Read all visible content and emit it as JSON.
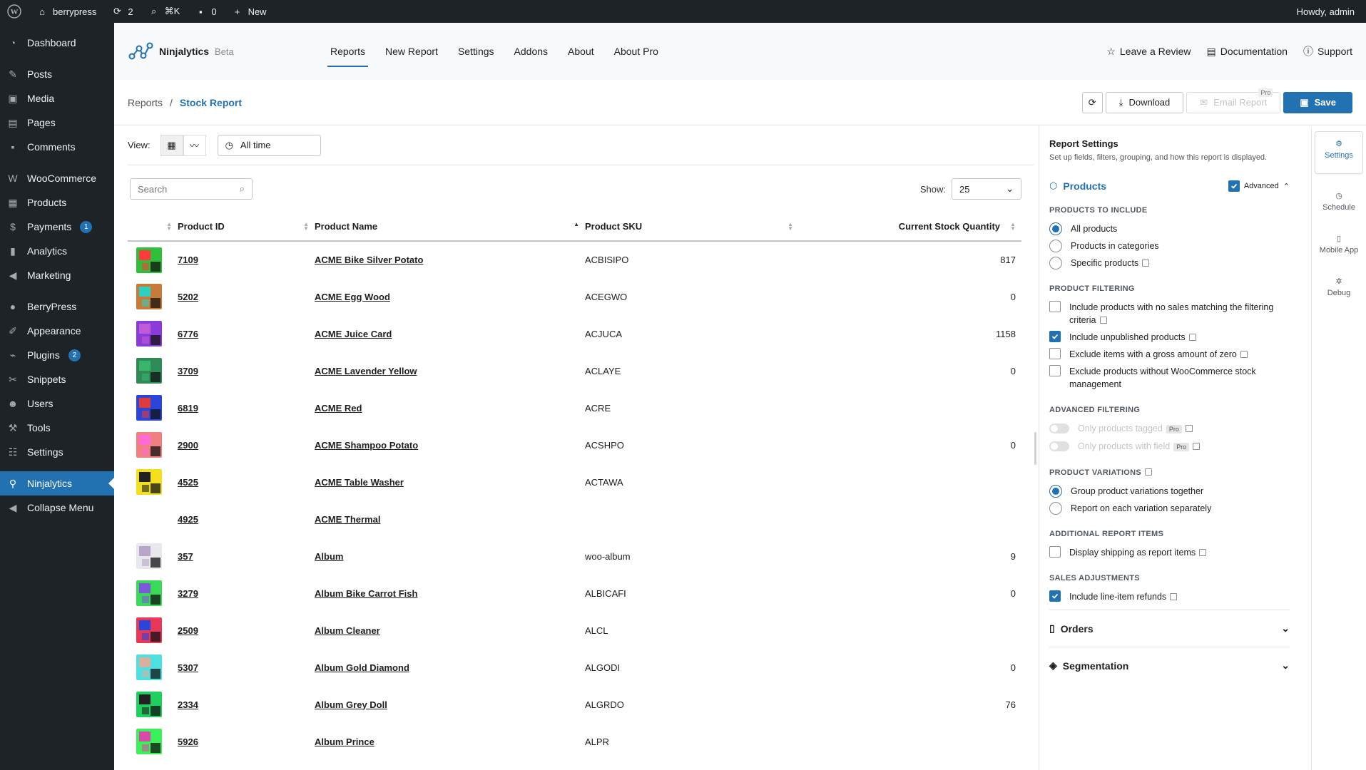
{
  "adminbar": {
    "site": "berrypress",
    "updates": "2",
    "shortcut": "⌘K",
    "comments": "0",
    "new": "New",
    "howdy": "Howdy, admin"
  },
  "sidebar": {
    "items": [
      {
        "label": "Dashboard",
        "icon": "dashboard-icon"
      },
      {
        "label": "Posts",
        "icon": "pin-icon"
      },
      {
        "label": "Media",
        "icon": "media-icon"
      },
      {
        "label": "Pages",
        "icon": "pages-icon"
      },
      {
        "label": "Comments",
        "icon": "comment-icon"
      },
      {
        "label": "WooCommerce",
        "icon": "woo-icon"
      },
      {
        "label": "Products",
        "icon": "box-icon"
      },
      {
        "label": "Payments",
        "icon": "dollar-icon",
        "badge": "1"
      },
      {
        "label": "Analytics",
        "icon": "bars-icon"
      },
      {
        "label": "Marketing",
        "icon": "megaphone-icon"
      },
      {
        "label": "BerryPress",
        "icon": "berry-icon"
      },
      {
        "label": "Appearance",
        "icon": "brush-icon"
      },
      {
        "label": "Plugins",
        "icon": "plug-icon",
        "badge": "2"
      },
      {
        "label": "Snippets",
        "icon": "scissors-icon"
      },
      {
        "label": "Users",
        "icon": "user-icon"
      },
      {
        "label": "Tools",
        "icon": "wrench-icon"
      },
      {
        "label": "Settings",
        "icon": "sliders-icon"
      },
      {
        "label": "Ninjalytics",
        "icon": "ninjalytics-icon"
      },
      {
        "label": "Collapse Menu",
        "icon": "collapse-icon"
      }
    ]
  },
  "app": {
    "name": "Ninjalytics",
    "beta": "Beta",
    "tabs": [
      "Reports",
      "New Report",
      "Settings",
      "Addons",
      "About",
      "About Pro"
    ],
    "links": [
      "Leave a Review",
      "Documentation",
      "Support"
    ]
  },
  "header": {
    "crumb_root": "Reports",
    "crumb_sep": "/",
    "crumb_current": "Stock Report",
    "download": "Download",
    "email": "Email Report",
    "pro": "Pro",
    "save": "Save"
  },
  "view": {
    "label": "View:",
    "time": "All time"
  },
  "table": {
    "search_placeholder": "Search",
    "show_label": "Show:",
    "show_value": "25",
    "columns": [
      "Product ID",
      "Product Name",
      "Product SKU",
      "Current Stock Quantity"
    ],
    "rows": [
      {
        "id": "7109",
        "name": "ACME Bike Silver Potato",
        "sku": "ACBISIPO",
        "qty": "817",
        "c1": "#2fbf3a",
        "c2": "#ff3b3b"
      },
      {
        "id": "5202",
        "name": "ACME Egg Wood",
        "sku": "ACEGWO",
        "qty": "0",
        "c1": "#c77b3b",
        "c2": "#2fd0c0"
      },
      {
        "id": "6776",
        "name": "ACME Juice Card",
        "sku": "ACJUCA",
        "qty": "1158",
        "c1": "#8a3bd8",
        "c2": "#c05ad8"
      },
      {
        "id": "3709",
        "name": "ACME Lavender Yellow",
        "sku": "ACLAYE",
        "qty": "0",
        "c1": "#2e8b57",
        "c2": "#3bb56a"
      },
      {
        "id": "6819",
        "name": "ACME Red",
        "sku": "ACRE",
        "qty": "",
        "c1": "#2b45d8",
        "c2": "#e03b3b"
      },
      {
        "id": "2900",
        "name": "ACME Shampoo Potato",
        "sku": "ACSHPO",
        "qty": "0",
        "c1": "#f08080",
        "c2": "#ff6ad5"
      },
      {
        "id": "4525",
        "name": "ACME Table Washer",
        "sku": "ACTAWA",
        "qty": "",
        "c1": "#f2e01d",
        "c2": "#222222"
      },
      {
        "id": "4925",
        "name": "ACME Thermal",
        "sku": "",
        "qty": "",
        "c1": "",
        "c2": ""
      },
      {
        "id": "357",
        "name": "Album",
        "sku": "woo-album",
        "qty": "9",
        "c1": "#e8e8ec",
        "c2": "#b8a6c8"
      },
      {
        "id": "3279",
        "name": "Album Bike Carrot Fish",
        "sku": "ALBICAFI",
        "qty": "0",
        "c1": "#3bd85a",
        "c2": "#7a5ad8"
      },
      {
        "id": "2509",
        "name": "Album Cleaner",
        "sku": "ALCL",
        "qty": "",
        "c1": "#e8385a",
        "c2": "#2b45d8"
      },
      {
        "id": "5307",
        "name": "Album Gold Diamond",
        "sku": "ALGODI",
        "qty": "0",
        "c1": "#4ee0e0",
        "c2": "#d8b0a0"
      },
      {
        "id": "2334",
        "name": "Album Grey Doll",
        "sku": "ALGRDO",
        "qty": "76",
        "c1": "#1fd060",
        "c2": "#222222"
      },
      {
        "id": "5926",
        "name": "Album Prince",
        "sku": "ALPR",
        "qty": "",
        "c1": "#3bf05a",
        "c2": "#d84aa8"
      }
    ]
  },
  "panel": {
    "title": "Report Settings",
    "subtitle": "Set up fields, filters, grouping, and how this report is displayed.",
    "section": "Products",
    "advanced": "Advanced",
    "include_cap": "Products to include",
    "include_opts": [
      "All products",
      "Products in categories",
      "Specific products"
    ],
    "filter_cap": "Product filtering",
    "filter_opts": [
      "Include products with no sales matching the filtering criteria",
      "Include unpublished products",
      "Exclude items with a gross amount of zero",
      "Exclude products without WooCommerce stock management"
    ],
    "adv_cap": "Advanced filtering",
    "adv_opts": [
      "Only products tagged",
      "Only products with field"
    ],
    "pro": "Pro",
    "var_cap": "Product variations",
    "var_opts": [
      "Group product variations together",
      "Report on each variation separately"
    ],
    "add_cap": "Additional report items",
    "add_opts": [
      "Display shipping as report items"
    ],
    "sales_cap": "Sales adjustments",
    "sales_opts": [
      "Include line-item refunds"
    ],
    "orders": "Orders",
    "segmentation": "Segmentation"
  },
  "rail": [
    "Settings",
    "Schedule",
    "Mobile App",
    "Debug"
  ],
  "colors": {
    "accent": "#2271b1",
    "admin_dark": "#1d2327"
  }
}
